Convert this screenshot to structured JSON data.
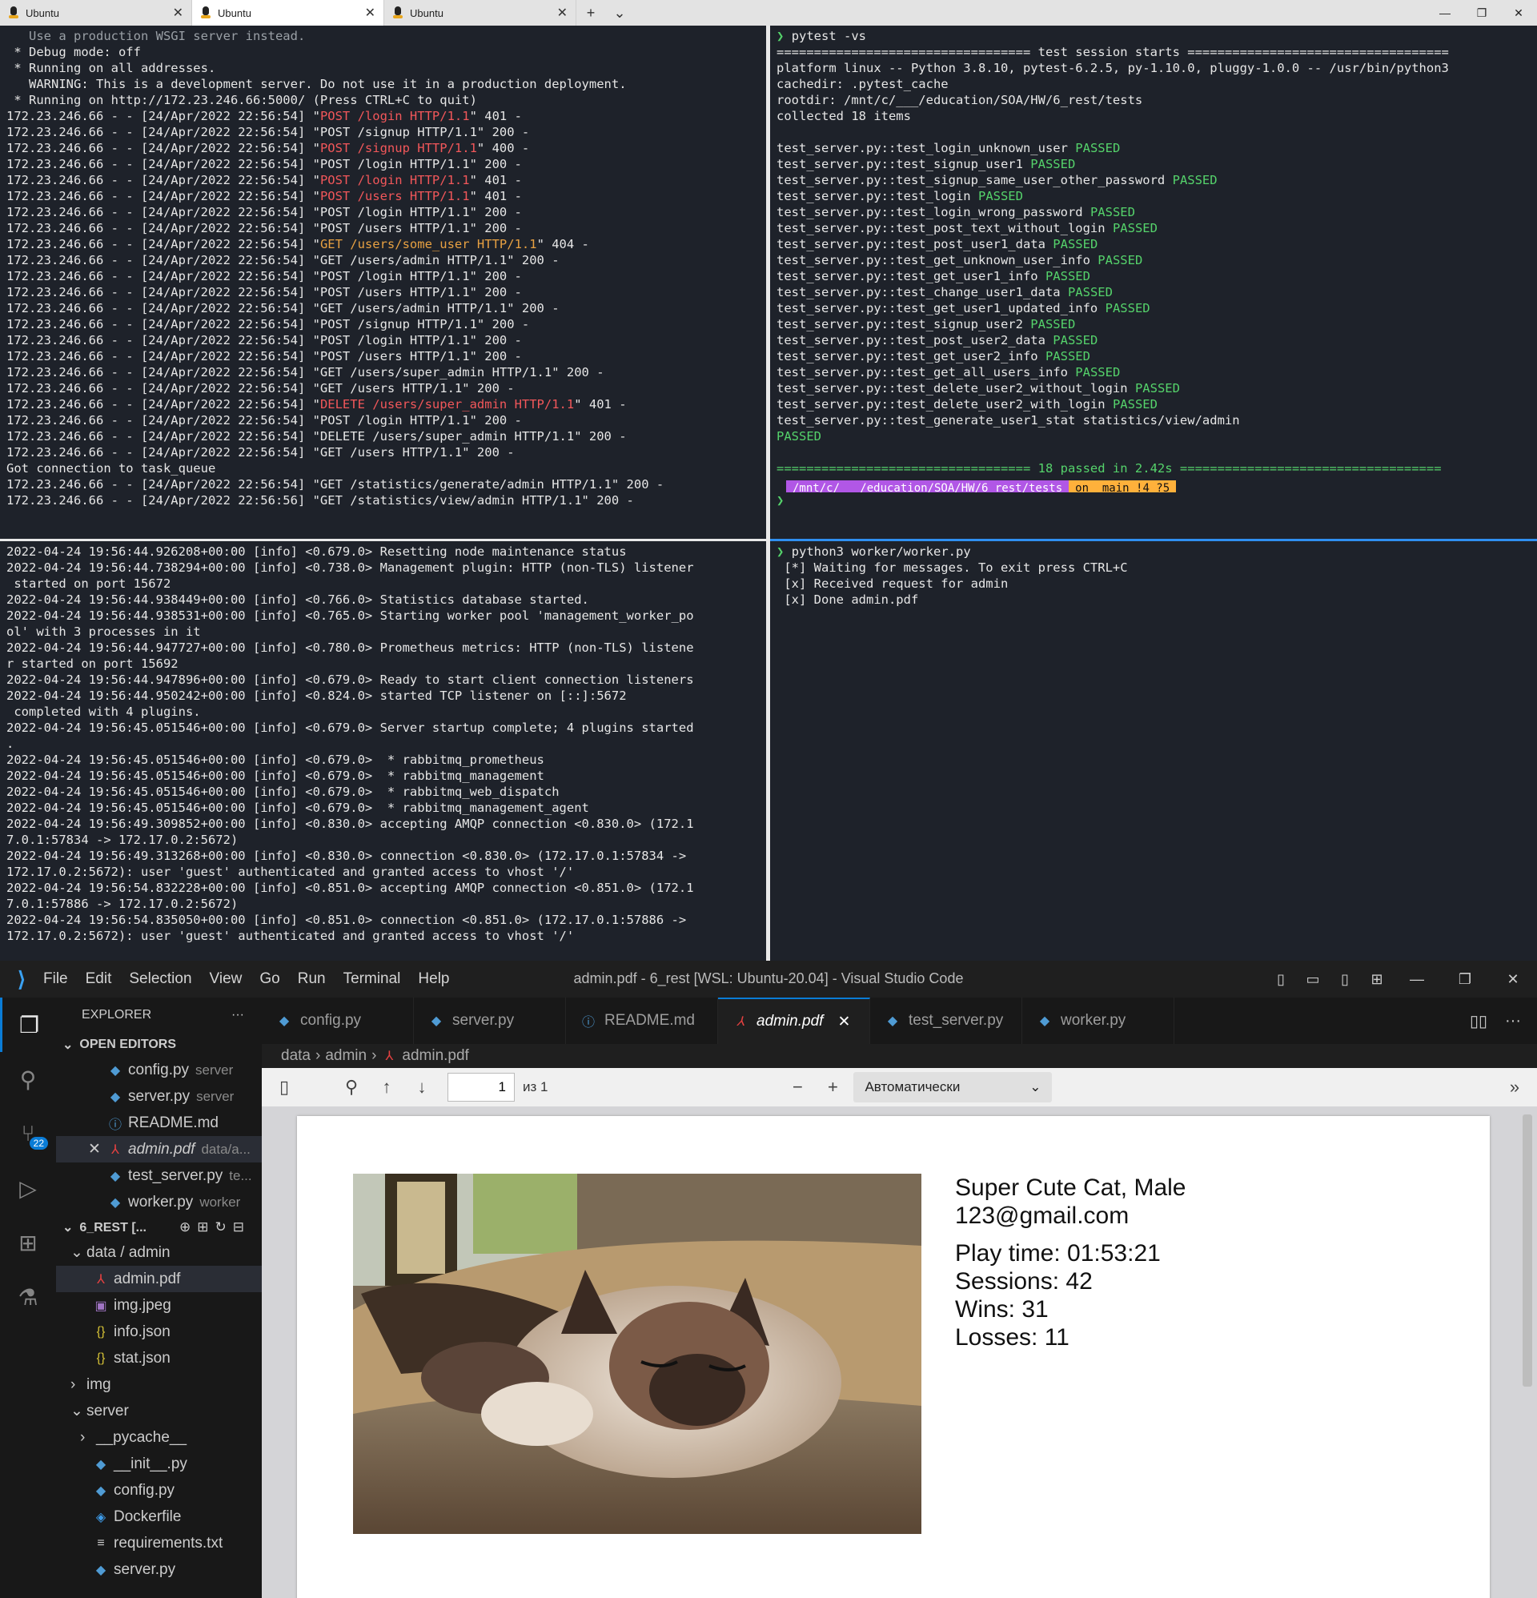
{
  "terminal": {
    "tabs": [
      {
        "label": "Ubuntu"
      },
      {
        "label": "Ubuntu"
      },
      {
        "label": "Ubuntu"
      }
    ],
    "new_tab": "+",
    "dropdown": "⌄",
    "server_log": [
      {
        "t": "   Use a production WSGI server instead.",
        "c": "gray"
      },
      {
        "t": " * Debug mode: off",
        "c": ""
      },
      {
        "t": " * Running on all addresses.",
        "c": ""
      },
      {
        "t": "   WARNING: This is a development server. Do not use it in a production deployment.",
        "c": ""
      },
      {
        "t": " * Running on http://172.23.246.66:5000/ (Press CTRL+C to quit)",
        "c": ""
      },
      {
        "p": "172.23.246.66 - - [24/Apr/2022 22:56:54] \"",
        "r": "POST /login HTTP/1.1",
        "s": "\" 401 -",
        "c": "red"
      },
      {
        "t": "172.23.246.66 - - [24/Apr/2022 22:56:54] \"POST /signup HTTP/1.1\" 200 -",
        "c": ""
      },
      {
        "p": "172.23.246.66 - - [24/Apr/2022 22:56:54] \"",
        "r": "POST /signup HTTP/1.1",
        "s": "\" 400 -",
        "c": "red"
      },
      {
        "t": "172.23.246.66 - - [24/Apr/2022 22:56:54] \"POST /login HTTP/1.1\" 200 -",
        "c": ""
      },
      {
        "p": "172.23.246.66 - - [24/Apr/2022 22:56:54] \"",
        "r": "POST /login HTTP/1.1",
        "s": "\" 401 -",
        "c": "red"
      },
      {
        "p": "172.23.246.66 - - [24/Apr/2022 22:56:54] \"",
        "r": "POST /users HTTP/1.1",
        "s": "\" 401 -",
        "c": "red"
      },
      {
        "t": "172.23.246.66 - - [24/Apr/2022 22:56:54] \"POST /login HTTP/1.1\" 200 -",
        "c": ""
      },
      {
        "t": "172.23.246.66 - - [24/Apr/2022 22:56:54] \"POST /users HTTP/1.1\" 200 -",
        "c": ""
      },
      {
        "p": "172.23.246.66 - - [24/Apr/2022 22:56:54] \"",
        "r": "GET /users/some_user HTTP/1.1",
        "s": "\" 404 -",
        "c": "orange"
      },
      {
        "t": "172.23.246.66 - - [24/Apr/2022 22:56:54] \"GET /users/admin HTTP/1.1\" 200 -",
        "c": ""
      },
      {
        "t": "172.23.246.66 - - [24/Apr/2022 22:56:54] \"POST /login HTTP/1.1\" 200 -",
        "c": ""
      },
      {
        "t": "172.23.246.66 - - [24/Apr/2022 22:56:54] \"POST /users HTTP/1.1\" 200 -",
        "c": ""
      },
      {
        "t": "172.23.246.66 - - [24/Apr/2022 22:56:54] \"GET /users/admin HTTP/1.1\" 200 -",
        "c": ""
      },
      {
        "t": "172.23.246.66 - - [24/Apr/2022 22:56:54] \"POST /signup HTTP/1.1\" 200 -",
        "c": ""
      },
      {
        "t": "172.23.246.66 - - [24/Apr/2022 22:56:54] \"POST /login HTTP/1.1\" 200 -",
        "c": ""
      },
      {
        "t": "172.23.246.66 - - [24/Apr/2022 22:56:54] \"POST /users HTTP/1.1\" 200 -",
        "c": ""
      },
      {
        "t": "172.23.246.66 - - [24/Apr/2022 22:56:54] \"GET /users/super_admin HTTP/1.1\" 200 -",
        "c": ""
      },
      {
        "t": "172.23.246.66 - - [24/Apr/2022 22:56:54] \"GET /users HTTP/1.1\" 200 -",
        "c": ""
      },
      {
        "p": "172.23.246.66 - - [24/Apr/2022 22:56:54] \"",
        "r": "DELETE /users/super_admin HTTP/1.1",
        "s": "\" 401 -",
        "c": "red"
      },
      {
        "t": "172.23.246.66 - - [24/Apr/2022 22:56:54] \"POST /login HTTP/1.1\" 200 -",
        "c": ""
      },
      {
        "t": "172.23.246.66 - - [24/Apr/2022 22:56:54] \"DELETE /users/super_admin HTTP/1.1\" 200 -",
        "c": ""
      },
      {
        "t": "172.23.246.66 - - [24/Apr/2022 22:56:54] \"GET /users HTTP/1.1\" 200 -",
        "c": ""
      },
      {
        "t": "Got connection to task_queue",
        "c": ""
      },
      {
        "t": "172.23.246.66 - - [24/Apr/2022 22:56:54] \"GET /statistics/generate/admin HTTP/1.1\" 200 -",
        "c": ""
      },
      {
        "t": "172.23.246.66 - - [24/Apr/2022 22:56:56] \"GET /statistics/view/admin HTTP/1.1\" 200 -",
        "c": ""
      }
    ],
    "pytest": {
      "command": "pytest -vs",
      "header": [
        "================================== test session starts ===================================",
        "platform linux -- Python 3.8.10, pytest-6.2.5, py-1.10.0, pluggy-1.0.0 -- /usr/bin/python3",
        "cachedir: .pytest_cache",
        "rootdir: /mnt/c/___/education/SOA/HW/6_rest/tests",
        "collected 18 items",
        ""
      ],
      "tests": [
        "test_server.py::test_login_unknown_user",
        "test_server.py::test_signup_user1",
        "test_server.py::test_signup_same_user_other_password",
        "test_server.py::test_login",
        "test_server.py::test_login_wrong_password",
        "test_server.py::test_post_text_without_login",
        "test_server.py::test_post_user1_data",
        "test_server.py::test_get_unknown_user_info",
        "test_server.py::test_get_user1_info",
        "test_server.py::test_change_user1_data",
        "test_server.py::test_get_user1_updated_info",
        "test_server.py::test_signup_user2",
        "test_server.py::test_post_user2_data",
        "test_server.py::test_get_user2_info",
        "test_server.py::test_get_all_users_info",
        "test_server.py::test_delete_user2_without_login",
        "test_server.py::test_delete_user2_with_login"
      ],
      "passed": "PASSED",
      "last_test": "test_server.py::test_generate_user1_stat statistics/view/admin",
      "summary": "================================== 18 passed in 2.42s ===================================",
      "prompt_icon": "",
      "prompt_path": "/mnt/c/___/education/SOA/HW/6_rest/tests",
      "prompt_git": "on  main !4 ?5",
      "prompt_char": "❯"
    },
    "rabbit_log": [
      "2022-04-24 19:56:44.926208+00:00 [info] <0.679.0> Resetting node maintenance status",
      "2022-04-24 19:56:44.738294+00:00 [info] <0.738.0> Management plugin: HTTP (non-TLS) listener",
      " started on port 15672",
      "2022-04-24 19:56:44.938449+00:00 [info] <0.766.0> Statistics database started.",
      "2022-04-24 19:56:44.938531+00:00 [info] <0.765.0> Starting worker pool 'management_worker_po",
      "ol' with 3 processes in it",
      "2022-04-24 19:56:44.947727+00:00 [info] <0.780.0> Prometheus metrics: HTTP (non-TLS) listene",
      "r started on port 15692",
      "2022-04-24 19:56:44.947896+00:00 [info] <0.679.0> Ready to start client connection listeners",
      "2022-04-24 19:56:44.950242+00:00 [info] <0.824.0> started TCP listener on [::]:5672",
      " completed with 4 plugins.",
      "2022-04-24 19:56:45.051546+00:00 [info] <0.679.0> Server startup complete; 4 plugins started",
      ".",
      "2022-04-24 19:56:45.051546+00:00 [info] <0.679.0>  * rabbitmq_prometheus",
      "2022-04-24 19:56:45.051546+00:00 [info] <0.679.0>  * rabbitmq_management",
      "2022-04-24 19:56:45.051546+00:00 [info] <0.679.0>  * rabbitmq_web_dispatch",
      "2022-04-24 19:56:45.051546+00:00 [info] <0.679.0>  * rabbitmq_management_agent",
      "2022-04-24 19:56:49.309852+00:00 [info] <0.830.0> accepting AMQP connection <0.830.0> (172.1",
      "7.0.1:57834 -> 172.17.0.2:5672)",
      "2022-04-24 19:56:49.313268+00:00 [info] <0.830.0> connection <0.830.0> (172.17.0.1:57834 ->",
      "172.17.0.2:5672): user 'guest' authenticated and granted access to vhost '/'",
      "2022-04-24 19:56:54.832228+00:00 [info] <0.851.0> accepting AMQP connection <0.851.0> (172.1",
      "7.0.1:57886 -> 172.17.0.2:5672)",
      "2022-04-24 19:56:54.835050+00:00 [info] <0.851.0> connection <0.851.0> (172.17.0.1:57886 ->",
      "172.17.0.2:5672): user 'guest' authenticated and granted access to vhost '/'"
    ],
    "worker": {
      "command": "python3 worker/worker.py",
      "lines": [
        " [*] Waiting for messages. To exit press CTRL+C",
        " [x] Received request for admin",
        " [x] Done admin.pdf"
      ]
    }
  },
  "vscode": {
    "menu": [
      "File",
      "Edit",
      "Selection",
      "View",
      "Go",
      "Run",
      "Terminal",
      "Help"
    ],
    "window_title": "admin.pdf - 6_rest [WSL: Ubuntu-20.04] - Visual Studio Code",
    "explorer_title": "EXPLORER",
    "more": "···",
    "open_editors_label": "OPEN EDITORS",
    "open_editors": [
      {
        "name": "config.py",
        "dir": "server",
        "icon": "py"
      },
      {
        "name": "server.py",
        "dir": "server",
        "icon": "py"
      },
      {
        "name": "README.md",
        "dir": "",
        "icon": "info"
      },
      {
        "name": "admin.pdf",
        "dir": "data/a...",
        "icon": "pdf"
      },
      {
        "name": "test_server.py",
        "dir": "te...",
        "icon": "py"
      },
      {
        "name": "worker.py",
        "dir": "worker",
        "icon": "py"
      }
    ],
    "project_label": "6_REST [...",
    "scm_badge": "22",
    "tree": [
      {
        "name": "data / admin",
        "indent": 1,
        "twist": "⌄",
        "icon": ""
      },
      {
        "name": "admin.pdf",
        "indent": 2,
        "twist": "",
        "icon": "pdf",
        "sel": true
      },
      {
        "name": "img.jpeg",
        "indent": 2,
        "twist": "",
        "icon": "img"
      },
      {
        "name": "info.json",
        "indent": 2,
        "twist": "",
        "icon": "js"
      },
      {
        "name": "stat.json",
        "indent": 2,
        "twist": "",
        "icon": "js"
      },
      {
        "name": "img",
        "indent": 1,
        "twist": "›",
        "icon": ""
      },
      {
        "name": "server",
        "indent": 1,
        "twist": "⌄",
        "icon": ""
      },
      {
        "name": "__pycache__",
        "indent": 2,
        "twist": "›",
        "icon": ""
      },
      {
        "name": "__init__.py",
        "indent": 2,
        "twist": "",
        "icon": "py"
      },
      {
        "name": "config.py",
        "indent": 2,
        "twist": "",
        "icon": "py"
      },
      {
        "name": "Dockerfile",
        "indent": 2,
        "twist": "",
        "icon": "dock"
      },
      {
        "name": "requirements.txt",
        "indent": 2,
        "twist": "",
        "icon": "txt"
      },
      {
        "name": "server.py",
        "indent": 2,
        "twist": "",
        "icon": "py"
      }
    ],
    "tabs": [
      {
        "name": "config.py",
        "icon": "py"
      },
      {
        "name": "server.py",
        "icon": "py"
      },
      {
        "name": "README.md",
        "icon": "info"
      },
      {
        "name": "admin.pdf",
        "icon": "pdf",
        "active": true
      },
      {
        "name": "test_server.py",
        "icon": "py"
      },
      {
        "name": "worker.py",
        "icon": "py"
      }
    ],
    "breadcrumb": [
      "data",
      "admin",
      "admin.pdf"
    ],
    "pdf": {
      "page": "1",
      "of": "из 1",
      "zoom": "Автоматически",
      "name_line": "Super Cute Cat, Male",
      "email": "123@gmail.com",
      "stats": [
        "Play time: 01:53:21",
        "Sessions: 42",
        "Wins: 31",
        "Losses: 11"
      ]
    }
  }
}
